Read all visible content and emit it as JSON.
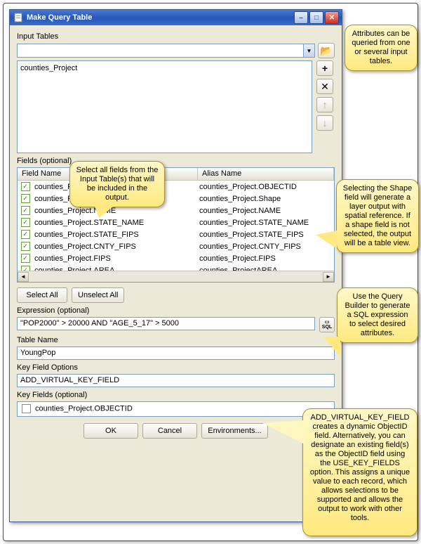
{
  "window": {
    "title": "Make Query Table"
  },
  "input_tables": {
    "label": "Input Tables",
    "selected": "",
    "list_item": "counties_Project"
  },
  "fields": {
    "label": "Fields (optional)",
    "headers": {
      "c1": "Field Name",
      "c2": "Alias Name"
    },
    "rows": [
      {
        "checked": true,
        "field": "counties_Project.OBJECTID",
        "alias": "counties_Project.OBJECTID"
      },
      {
        "checked": true,
        "field": "counties_Project.Shape",
        "alias": "counties_Project.Shape"
      },
      {
        "checked": true,
        "field": "counties_Project.NAME",
        "alias": "counties_Project.NAME"
      },
      {
        "checked": true,
        "field": "counties_Project.STATE_NAME",
        "alias": "counties_Project.STATE_NAME"
      },
      {
        "checked": true,
        "field": "counties_Project.STATE_FIPS",
        "alias": "counties_Project.STATE_FIPS"
      },
      {
        "checked": true,
        "field": "counties_Project.CNTY_FIPS",
        "alias": "counties_Project.CNTY_FIPS"
      },
      {
        "checked": true,
        "field": "counties_Project.FIPS",
        "alias": "counties_Project.FIPS"
      },
      {
        "checked": true,
        "field": "counties_Project.AREA",
        "alias": "counties_ProjectAREA"
      }
    ],
    "select_all": "Select All",
    "unselect_all": "Unselect All"
  },
  "expression": {
    "label": "Expression (optional)",
    "value": "\"POP2000\" > 20000 AND \"AGE_5_17\" > 5000",
    "sql_btn": "SQL"
  },
  "table_name": {
    "label": "Table Name",
    "value": "YoungPop"
  },
  "key_field_options": {
    "label": "Key Field Options",
    "value": "ADD_VIRTUAL_KEY_FIELD"
  },
  "key_fields": {
    "label": "Key Fields (optional)",
    "item": "counties_Project.OBJECTID",
    "checked": false
  },
  "bottom": {
    "ok": "OK",
    "cancel": "Cancel",
    "env": "Environments..."
  },
  "callouts": {
    "c1": "Attributes can be queried from one or several input tables.",
    "c2": "Select all fields from the Input Table(s) that will be included in the output.",
    "c3": "Selecting the Shape field will generate a layer output with spatial reference. If a shape field is not selected, the output will be a table view.",
    "c4": "Use the Query Builder to generate a SQL expression to select desired attributes.",
    "c5": "ADD_VIRTUAL_KEY_FIELD creates a dynamic ObjectID field.  Alternatively, you can designate an existing field(s) as the ObjectID field using the USE_KEY_FIELDS option. This assigns a unique value to each record, which allows selections to be supported and allows the output to work with other tools."
  }
}
